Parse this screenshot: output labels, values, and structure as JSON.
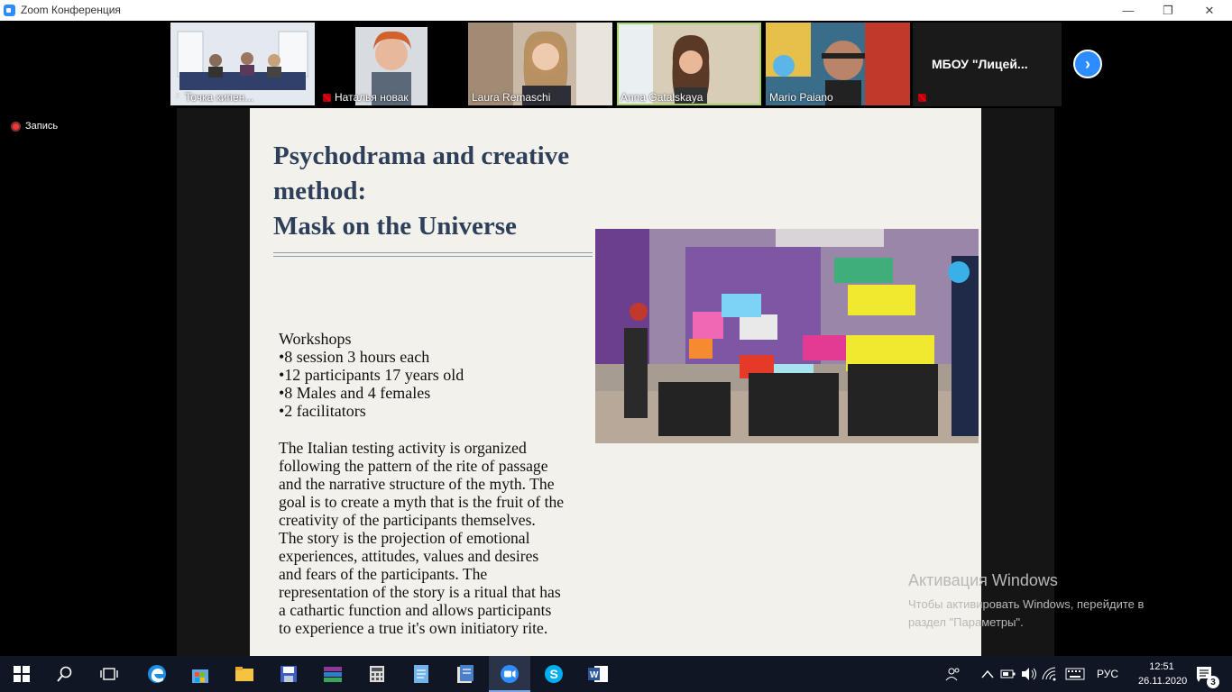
{
  "window": {
    "title": "Zoom Конференция"
  },
  "participants": [
    {
      "name": "Точка кипен...",
      "icon": "pin-icon"
    },
    {
      "name": "Наталья новак",
      "icon": "mic-muted-icon"
    },
    {
      "name": "Laura Remaschi",
      "icon": ""
    },
    {
      "name": "Anna Gatalskaya",
      "icon": ""
    },
    {
      "name": "Mario Paiano",
      "icon": ""
    }
  ],
  "extra_participant": "МБОУ  \"Лицей...",
  "recording": "Запись",
  "slide": {
    "title_lines": [
      "Psychodrama and creative",
      "method:",
      "Mask on the Universe"
    ],
    "workshops": [
      "Workshops",
      "•8 session 3 hours each",
      "•12 participants 17 years old",
      "•8 Males and 4 females",
      "•2 facilitators"
    ],
    "body_lines": [
      "The Italian testing activity is organized",
      "following the pattern of the rite of passage",
      "and the narrative structure of the myth. The",
      "goal is to create a myth that is the fruit of the",
      "creativity of the participants themselves.",
      "The story is the projection of emotional",
      "experiences, attitudes, values and desires",
      "and fears of the participants. The",
      "representation of the story is a ritual that has",
      "a cathartic function and allows participants",
      "to experience a true it's own initiatory rite."
    ]
  },
  "activation": {
    "title": "Активация Windows",
    "line1": "Чтобы активировать Windows, перейдите в",
    "line2": "раздел \"Параметры\"."
  },
  "taskbar": {
    "lang": "РУС",
    "time": "12:51",
    "date": "26.11.2020",
    "notifications": "3"
  }
}
